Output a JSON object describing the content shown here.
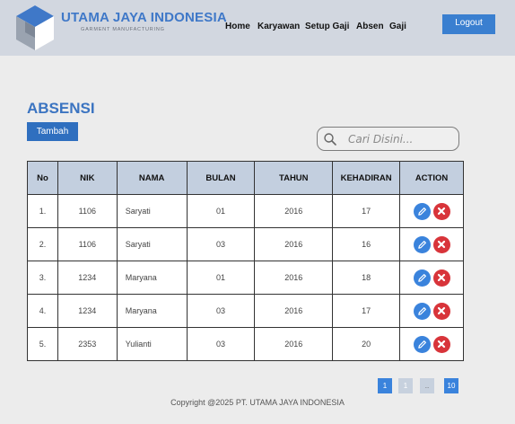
{
  "brand": {
    "name": "UTAMA JAYA INDONESIA",
    "subtitle": "GARMENT MANUFACTURING"
  },
  "nav": {
    "home": "Home",
    "karyawan": "Karyawan",
    "setup_gaji": "Setup Gaji",
    "absen": "Absen",
    "gaji": "Gaji",
    "logout": "Logout"
  },
  "page": {
    "title": "ABSENSI",
    "add_button": "Tambah"
  },
  "search": {
    "placeholder": "Cari Disini..."
  },
  "table": {
    "headers": [
      "No",
      "NIK",
      "NAMA",
      "BULAN",
      "TAHUN",
      "KEHADIRAN",
      "ACTION"
    ],
    "rows": [
      {
        "no": "1.",
        "nik": "1106",
        "nama": "Saryati",
        "bulan": "01",
        "tahun": "2016",
        "kehadiran": "17"
      },
      {
        "no": "2.",
        "nik": "1106",
        "nama": "Saryati",
        "bulan": "03",
        "tahun": "2016",
        "kehadiran": "16"
      },
      {
        "no": "3.",
        "nik": "1234",
        "nama": "Maryana",
        "bulan": "01",
        "tahun": "2016",
        "kehadiran": "18"
      },
      {
        "no": "4.",
        "nik": "1234",
        "nama": "Maryana",
        "bulan": "03",
        "tahun": "2016",
        "kehadiran": "17"
      },
      {
        "no": "5.",
        "nik": "2353",
        "nama": "Yulianti",
        "bulan": "03",
        "tahun": "2016",
        "kehadiran": "20"
      }
    ]
  },
  "pagination": {
    "pages": [
      "1",
      "1",
      "..",
      "10"
    ],
    "active_index": 0
  },
  "footer": {
    "copyright": "Copyright @2025 PT. UTAMA JAYA INDONESIA"
  },
  "icons": {
    "logo": "cube-logo-icon",
    "search": "search-icon",
    "edit": "pencil-icon",
    "delete": "close-icon"
  },
  "colors": {
    "header_bg": "#d2d7e0",
    "brand": "#3f78c8",
    "accent": "#3a7fd0",
    "table_header": "#c3cfdf",
    "delete": "#d8343a",
    "page_active": "#3a83dc",
    "page_inactive": "#c7d1de"
  }
}
